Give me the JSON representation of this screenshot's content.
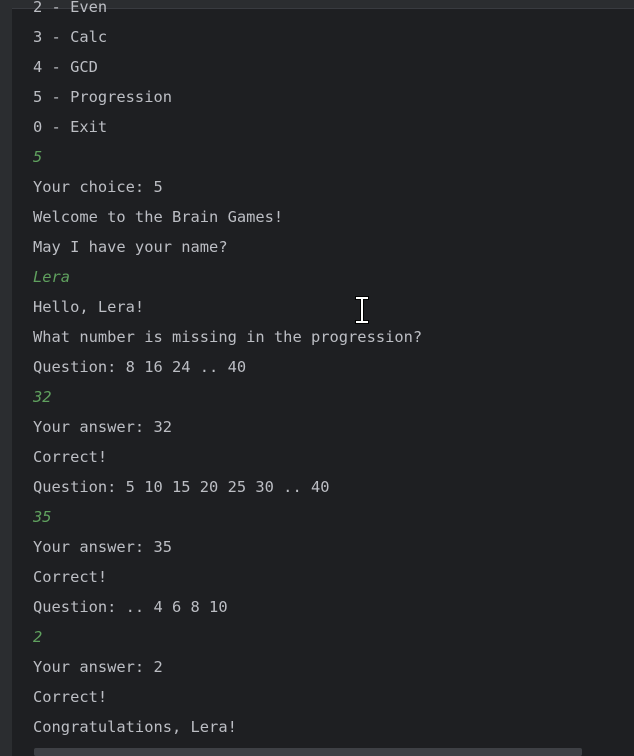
{
  "console": {
    "lines": [
      {
        "text": "2 - Even",
        "kind": "output"
      },
      {
        "text": "3 - Calc",
        "kind": "output"
      },
      {
        "text": "4 - GCD",
        "kind": "output"
      },
      {
        "text": "5 - Progression",
        "kind": "output"
      },
      {
        "text": "0 - Exit",
        "kind": "output"
      },
      {
        "text": "5",
        "kind": "input"
      },
      {
        "text": "Your choice: 5",
        "kind": "output"
      },
      {
        "text": "Welcome to the Brain Games!",
        "kind": "output"
      },
      {
        "text": "May I have your name?",
        "kind": "output"
      },
      {
        "text": "Lera",
        "kind": "input"
      },
      {
        "text": "Hello, Lera!",
        "kind": "output"
      },
      {
        "text": "What number is missing in the progression?",
        "kind": "output"
      },
      {
        "text": "Question: 8 16 24 .. 40",
        "kind": "output"
      },
      {
        "text": "32",
        "kind": "input"
      },
      {
        "text": "Your answer: 32",
        "kind": "output"
      },
      {
        "text": "Correct!",
        "kind": "output"
      },
      {
        "text": "Question: 5 10 15 20 25 30 .. 40",
        "kind": "output"
      },
      {
        "text": "35",
        "kind": "input"
      },
      {
        "text": "Your answer: 35",
        "kind": "output"
      },
      {
        "text": "Correct!",
        "kind": "output"
      },
      {
        "text": "Question: .. 4 6 8 10",
        "kind": "output"
      },
      {
        "text": "2",
        "kind": "input"
      },
      {
        "text": "Your answer: 2",
        "kind": "output"
      },
      {
        "text": "Correct!",
        "kind": "output"
      },
      {
        "text": "Congratulations, Lera!",
        "kind": "output"
      }
    ]
  },
  "colors": {
    "background": "#1e1f22",
    "output_text": "#bcbec4",
    "user_input_text": "#5fa05e"
  },
  "icons": {
    "cursor": "text-cursor-icon"
  }
}
